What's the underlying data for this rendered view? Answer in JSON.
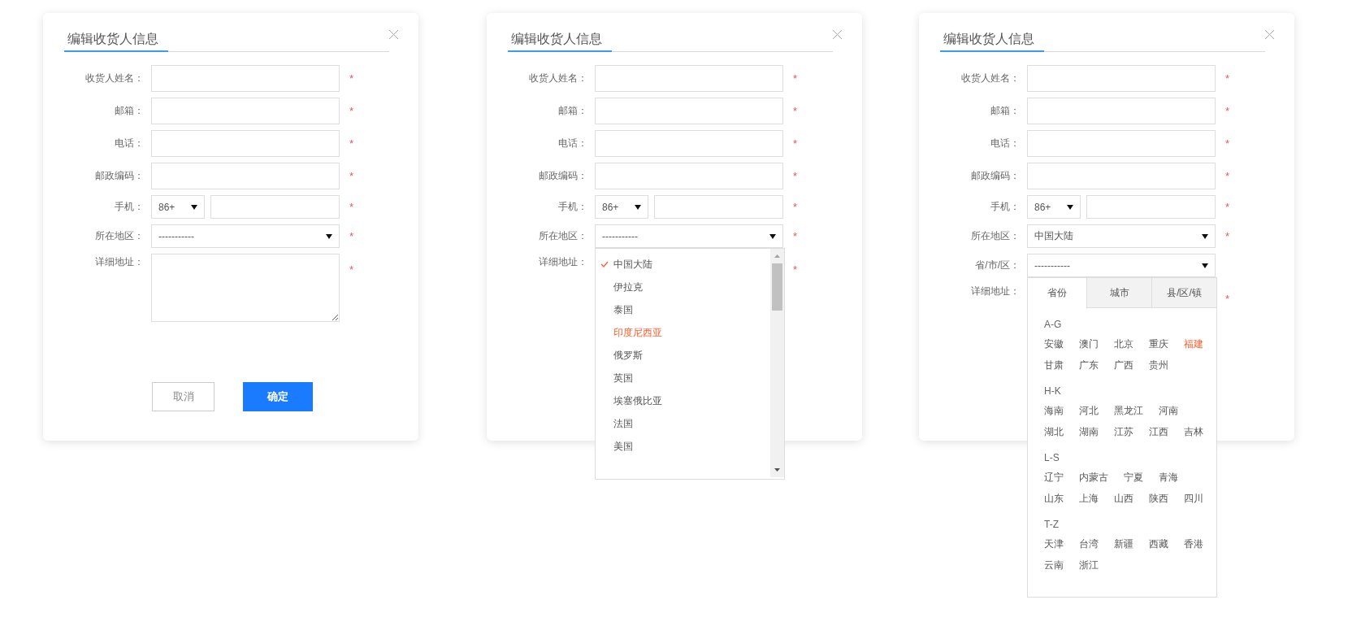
{
  "panels": [
    {
      "title": "编辑收货人信息",
      "fields": [
        {
          "kind": "text",
          "label": "收货人姓名：",
          "mark": "*"
        },
        {
          "kind": "text",
          "label": "邮箱：",
          "mark": "*"
        },
        {
          "kind": "text",
          "label": "电话：",
          "mark": "*"
        },
        {
          "kind": "text",
          "label": "邮政编码：",
          "mark": "*"
        },
        {
          "kind": "phone",
          "label": "手机：",
          "code": "86+",
          "mark": "*"
        },
        {
          "kind": "select",
          "label": "所在地区：",
          "value": "-----------",
          "mark": "*"
        },
        {
          "kind": "textarea",
          "label": "详细地址：",
          "mark": "*"
        }
      ],
      "buttons": [
        {
          "kind": "cancel",
          "label": "取消"
        },
        {
          "kind": "primary",
          "label": "确定"
        }
      ]
    },
    {
      "title": "编辑收货人信息",
      "fields": [
        {
          "kind": "text",
          "label": "收货人姓名：",
          "mark": "*"
        },
        {
          "kind": "text",
          "label": "邮箱：",
          "mark": "*"
        },
        {
          "kind": "text",
          "label": "电话：",
          "mark": "*"
        },
        {
          "kind": "text",
          "label": "邮政编码：",
          "mark": "*"
        },
        {
          "kind": "phone",
          "label": "手机：",
          "code": "86+",
          "mark": "*"
        },
        {
          "kind": "select",
          "label": "所在地区：",
          "value": "-----------",
          "mark": "*",
          "dropdown": {
            "kind": "list",
            "items": [
              {
                "name": "中国大陆",
                "selected": true,
                "hovered": false
              },
              {
                "name": "伊拉克",
                "selected": false,
                "hovered": false
              },
              {
                "name": "泰国",
                "selected": false,
                "hovered": false
              },
              {
                "name": "印度尼西亚",
                "selected": false,
                "hovered": true
              },
              {
                "name": "俄罗斯",
                "selected": false,
                "hovered": false
              },
              {
                "name": "英国",
                "selected": false,
                "hovered": false
              },
              {
                "name": "埃塞俄比亚",
                "selected": false,
                "hovered": false
              },
              {
                "name": "法国",
                "selected": false,
                "hovered": false
              },
              {
                "name": "美国",
                "selected": false,
                "hovered": false
              }
            ]
          }
        },
        {
          "kind": "label",
          "label": "详细地址：",
          "mark": "*"
        }
      ]
    },
    {
      "title": "编辑收货人信息",
      "fields": [
        {
          "kind": "text",
          "label": "收货人姓名：",
          "mark": "*"
        },
        {
          "kind": "text",
          "label": "邮箱：",
          "mark": "*"
        },
        {
          "kind": "text",
          "label": "电话：",
          "mark": "*"
        },
        {
          "kind": "text",
          "label": "邮政编码：",
          "mark": "*"
        },
        {
          "kind": "phone",
          "label": "手机：",
          "code": "86+",
          "mark": "*"
        },
        {
          "kind": "select",
          "label": "所在地区：",
          "value": "中国大陆",
          "mark": "*"
        },
        {
          "kind": "select",
          "label": "省/市/区：",
          "value": "-----------",
          "dropdown": {
            "kind": "tabs",
            "tabs": [
              {
                "label": "省份",
                "selected": true
              },
              {
                "label": "城市",
                "selected": false
              },
              {
                "label": "县/区/镇",
                "selected": false
              }
            ],
            "groups": [
              {
                "letter": "A-G",
                "items": [
                  {
                    "name": "安徽",
                    "selected": false
                  },
                  {
                    "name": "澳门",
                    "selected": false
                  },
                  {
                    "name": "北京",
                    "selected": false
                  },
                  {
                    "name": "重庆",
                    "selected": false
                  },
                  {
                    "name": "福建",
                    "selected": true
                  },
                  {
                    "name": "甘肃",
                    "selected": false
                  },
                  {
                    "name": "广东",
                    "selected": false
                  },
                  {
                    "name": "广西",
                    "selected": false
                  },
                  {
                    "name": "贵州",
                    "selected": false
                  }
                ]
              },
              {
                "letter": "H-K",
                "items": [
                  {
                    "name": "海南",
                    "selected": false
                  },
                  {
                    "name": "河北",
                    "selected": false
                  },
                  {
                    "name": "黑龙江",
                    "selected": false
                  },
                  {
                    "name": "河南",
                    "selected": false
                  },
                  {
                    "name": "湖北",
                    "selected": false
                  },
                  {
                    "name": "湖南",
                    "selected": false
                  },
                  {
                    "name": "江苏",
                    "selected": false
                  },
                  {
                    "name": "江西",
                    "selected": false
                  },
                  {
                    "name": "吉林",
                    "selected": false
                  }
                ]
              },
              {
                "letter": "L-S",
                "items": [
                  {
                    "name": "辽宁",
                    "selected": false
                  },
                  {
                    "name": "内蒙古",
                    "selected": false
                  },
                  {
                    "name": "宁夏",
                    "selected": false
                  },
                  {
                    "name": "青海",
                    "selected": false
                  },
                  {
                    "name": "山东",
                    "selected": false
                  },
                  {
                    "name": "上海",
                    "selected": false
                  },
                  {
                    "name": "山西",
                    "selected": false
                  },
                  {
                    "name": "陕西",
                    "selected": false
                  },
                  {
                    "name": "四川",
                    "selected": false
                  }
                ]
              },
              {
                "letter": "T-Z",
                "items": [
                  {
                    "name": "天津",
                    "selected": false
                  },
                  {
                    "name": "台湾",
                    "selected": false
                  },
                  {
                    "name": "新疆",
                    "selected": false
                  },
                  {
                    "name": "西藏",
                    "selected": false
                  },
                  {
                    "name": "香港",
                    "selected": false
                  },
                  {
                    "name": "云南",
                    "selected": false
                  },
                  {
                    "name": "浙江",
                    "selected": false
                  }
                ]
              }
            ]
          }
        },
        {
          "kind": "label",
          "label": "详细地址：",
          "mark": "*"
        }
      ]
    }
  ]
}
